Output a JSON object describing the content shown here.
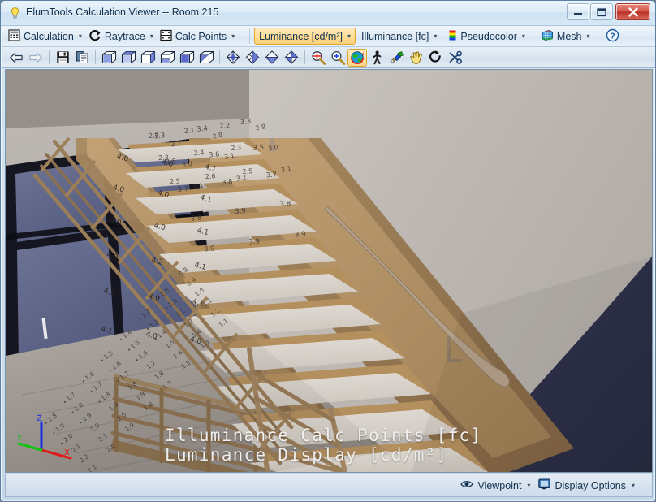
{
  "window": {
    "title": "ElumTools Calculation Viewer -- Room 215",
    "icon": "lightbulb-icon",
    "controls": {
      "minimize": "minimize-button",
      "maximize": "maximize-button",
      "close": "close-button"
    }
  },
  "menubar": {
    "items": [
      {
        "label": "Calculation",
        "icon": "calculator-icon",
        "caret": "▾",
        "selected": false
      },
      {
        "label": "Raytrace",
        "icon": "raytrace-icon",
        "caret": "▾",
        "selected": false
      },
      {
        "label": "Calc Points",
        "icon": "calc-points-icon",
        "caret": "▾",
        "selected": false
      },
      {
        "label": "Luminance [cd/m²]",
        "icon": "",
        "caret": "▾",
        "selected": true
      },
      {
        "label": "Illuminance [fc]",
        "icon": "",
        "caret": "▾",
        "selected": false
      },
      {
        "label": "Pseudocolor",
        "icon": "colorbar-icon",
        "caret": "▾",
        "selected": false
      },
      {
        "label": "Mesh",
        "icon": "mesh-icon",
        "caret": "▾",
        "selected": false
      },
      {
        "label": "",
        "icon": "help-icon",
        "caret": "",
        "selected": false
      }
    ]
  },
  "toolbar": {
    "buttons": [
      {
        "name": "back-arrow-icon",
        "selected": false
      },
      {
        "name": "forward-arrow-icon",
        "selected": false
      },
      {
        "name": "save-icon",
        "selected": false
      },
      {
        "name": "copy-icon",
        "selected": false
      },
      {
        "name": "view-iso-icon",
        "selected": false
      },
      {
        "name": "view-top-icon",
        "selected": false
      },
      {
        "name": "view-front-icon",
        "selected": false
      },
      {
        "name": "view-side-icon",
        "selected": false
      },
      {
        "name": "view-bottom-icon",
        "selected": false
      },
      {
        "name": "view-back-icon",
        "selected": false
      },
      {
        "name": "view-rotate-1-icon",
        "selected": false
      },
      {
        "name": "view-rotate-2-icon",
        "selected": false
      },
      {
        "name": "view-rotate-3-icon",
        "selected": false
      },
      {
        "name": "view-rotate-4-icon",
        "selected": false
      },
      {
        "name": "view-rotate-5-icon",
        "selected": false
      },
      {
        "name": "zoom-window-icon",
        "selected": false
      },
      {
        "name": "zoom-in-icon",
        "selected": false
      },
      {
        "name": "orbit-globe-icon",
        "selected": true
      },
      {
        "name": "walk-icon",
        "selected": false
      },
      {
        "name": "render-icon",
        "selected": false
      },
      {
        "name": "pan-hand-icon",
        "selected": false
      },
      {
        "name": "refresh-icon",
        "selected": false
      },
      {
        "name": "clip-scissors-icon",
        "selected": false
      }
    ]
  },
  "viewport": {
    "overlay_line1": "Illuminance Calc Points [fc]",
    "overlay_line2": "Luminance Display [cd/m²]",
    "axis_triad": {
      "x": "X",
      "y": "Y",
      "z": "Z",
      "x_color": "#e01b1b",
      "y_color": "#12c212",
      "z_color": "#1b2ee0"
    },
    "calc_point_values": [
      "4.0",
      "4.0",
      "4.1",
      "4.0",
      "4.0",
      "4.1",
      "4.0",
      "4.0",
      "4.1",
      "4.0",
      "4.2",
      "4.1",
      "4.1",
      "4.0",
      "3.9",
      "3.9",
      "3.8",
      "3.9",
      "3.7",
      "3.6",
      "3.5",
      "3.4",
      "3.3",
      "3.2",
      "3.1",
      "3.0",
      "2.9",
      "2.8",
      "2.7",
      "2.6",
      "2.5",
      "2.4",
      "2.3",
      "2.2",
      "2.1",
      "2.0",
      "1.9",
      "1.8",
      "1.7",
      "1.6",
      "1.5",
      "1.4",
      "1.3",
      "1.2",
      "1.1",
      "1.0",
      "0.9",
      "0.8"
    ]
  },
  "statusbar": {
    "items": [
      {
        "label": "Viewpoint",
        "icon": "eye-icon",
        "caret": "▾"
      },
      {
        "label": "Display Options",
        "icon": "monitor-icon",
        "caret": "▾"
      }
    ]
  },
  "colors": {
    "accent_selected": "#ffd98c",
    "accent_border": "#e0a32e",
    "chrome": "#d7e5f1",
    "wall": "#b3aeab",
    "wood": "#b59468",
    "glass": "#5d6488",
    "dark_wall": "#2e3048"
  }
}
